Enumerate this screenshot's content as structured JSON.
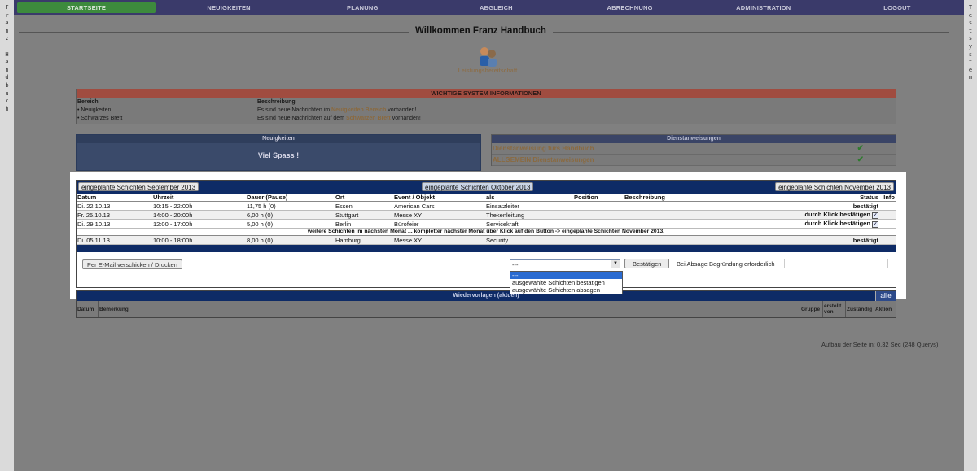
{
  "sidebar_left": [
    "F",
    "r",
    "a",
    "n",
    "z",
    "",
    "H",
    "a",
    "n",
    "d",
    "b",
    "u",
    "c",
    "h"
  ],
  "sidebar_right": [
    "T",
    "e",
    "s",
    "t",
    "s",
    "y",
    "s",
    "t",
    "e",
    "m"
  ],
  "nav": {
    "items": [
      "STARTSEITE",
      "NEUIGKEITEN",
      "PLANUNG",
      "ABGLEICH",
      "ABRECHNUNG",
      "ADMINISTRATION",
      "LOGOUT"
    ],
    "active_color": "#3d8a3d"
  },
  "welcome": "Willkommen Franz Handbuch",
  "standby_label": "Leistungsbereitschaft",
  "sysinfo": {
    "title": "WICHTIGE SYSTEM INFORMATIONEN",
    "col_area": "Bereich",
    "col_desc": "Beschreibung",
    "rows": [
      {
        "area": "• Neuigkeiten",
        "pre": "Es sind neue Nachrichten im ",
        "link": "Neuigkeiten Bereich",
        "post": " vorhanden!"
      },
      {
        "area": "• Schwarzes Brett",
        "pre": "Es sind neue Nachrichten auf dem ",
        "link": "Schwarzen Brett",
        "post": " vorhanden!"
      }
    ]
  },
  "news": {
    "title": "Neuigkeiten",
    "body": "Viel Spass !"
  },
  "instructions": {
    "title": "Dienstanweisungen",
    "items": [
      "Dienstanweisung fürs Handbuch",
      "ALLGEMEIN Dienstanweisungen"
    ]
  },
  "months": {
    "prev": "eingeplante Schichten September 2013",
    "current": "eingeplante Schichten Oktober 2013",
    "next": "eingeplante Schichten November 2013"
  },
  "shift_columns": [
    "Datum",
    "Uhrzeit",
    "Dauer (Pause)",
    "Ort",
    "Event / Objekt",
    "als",
    "Position",
    "Beschreibung",
    "Status",
    "Info"
  ],
  "shifts": [
    {
      "date": "Di. 22.10.13",
      "time": "10:15 - 22:00h",
      "duration": "11,75 h (0)",
      "place": "Essen",
      "event": "American Cars",
      "role": "Einsatzleiter",
      "status": "bestätigt",
      "status_type": "ok"
    },
    {
      "date": "Fr. 25.10.13",
      "time": "14:00 - 20:00h",
      "duration": "6,00 h (0)",
      "place": "Stuttgart",
      "event": "Messe XY",
      "role": "Thekenleitung",
      "status": "durch Klick bestätigen",
      "status_type": "klick"
    },
    {
      "date": "Di. 29.10.13",
      "time": "12:00 - 17:00h",
      "duration": "5,00 h (0)",
      "place": "Berlin",
      "event": "Bürofeier",
      "role": "Servicekraft",
      "status": "durch Klick bestätigen",
      "status_type": "klick"
    }
  ],
  "next_month_note": "weitere Schichten im nächsten Monat ... kompletter nächster Monat über Klick auf den Button -> eingeplante Schichten November 2013.",
  "next_shift": {
    "date": "Di. 05.11.13",
    "time": "10:00 - 18:00h",
    "duration": "8,00 h (0)",
    "place": "Hamburg",
    "event": "Messe XY",
    "role": "Security",
    "status": "bestätigt"
  },
  "controls": {
    "print": "Per E-Mail verschicken / Drucken",
    "select_value": "---",
    "options": [
      "---",
      "ausgewählte Schichten bestätigen",
      "ausgewählte Schichten absagen"
    ],
    "confirm": "Bestätigen",
    "reason_label": "Bei Absage Begründung erforderlich"
  },
  "templates": {
    "title": "Wiedervorlagen (aktuell)",
    "alle": "alle",
    "columns": [
      "Datum",
      "Bemerkung",
      "Gruppe",
      "erstellt von",
      "Zuständig",
      "Aktion"
    ]
  },
  "footer": "Aufbau der Seite in: 0,32 Sec (248 Querys)",
  "colors": {
    "ok": "#1c8a1c",
    "klick": "#c7843f",
    "header_blue": "#0e2b66"
  }
}
